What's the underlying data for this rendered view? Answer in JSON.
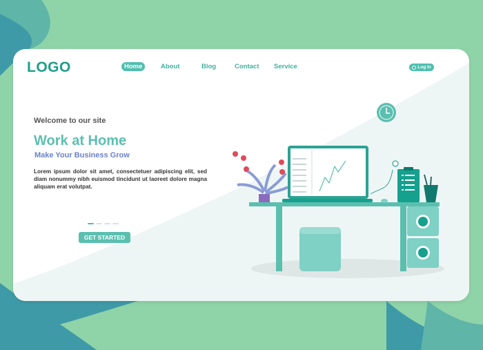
{
  "brand": {
    "logo": "LOGO"
  },
  "nav": {
    "items": [
      {
        "label": "Home",
        "active": true
      },
      {
        "label": "About",
        "active": false
      },
      {
        "label": "Blog",
        "active": false
      },
      {
        "label": "Contact",
        "active": false
      },
      {
        "label": "Service",
        "active": false
      }
    ],
    "login_label": "Log In"
  },
  "hero": {
    "welcome": "Welcome to our site",
    "headline": "Work at Home",
    "subheadline": "Make Your Business Grow",
    "body": "Lorem ipsum dolor sit amet, consectetuer adipiscing elit, sed diam nonummy nibh euismod tincidunt ut laoreet dolore magna aliquam erat volutpat.",
    "cta_label": "GET STARTED",
    "slider": {
      "count": 4,
      "active_index": 0
    }
  },
  "colors": {
    "page_bg": "#8fd3a8",
    "teal": "#4fbfb0",
    "teal_dark": "#1d9e8a",
    "accent_blue": "#6a82c9"
  }
}
